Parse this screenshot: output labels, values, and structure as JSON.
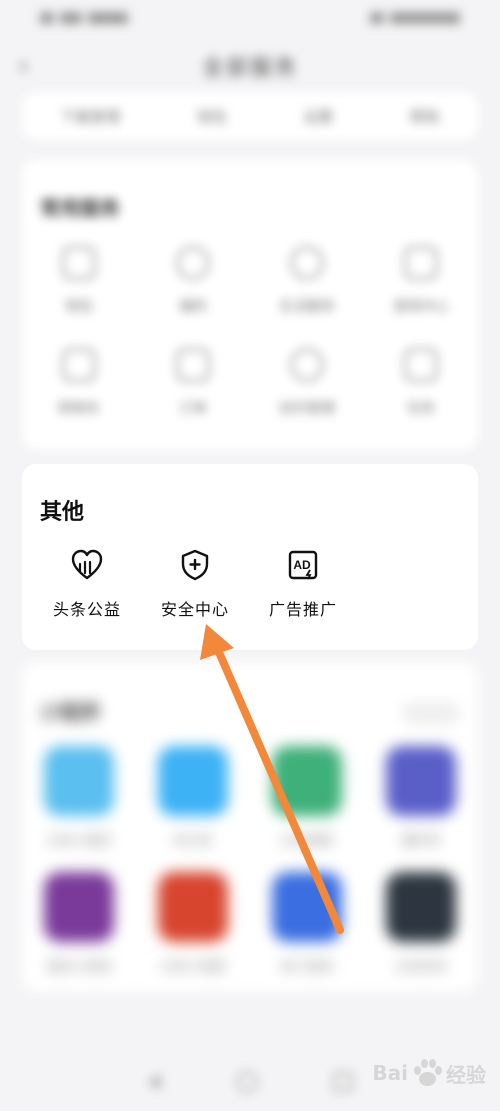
{
  "status_bar": {
    "left": "▮ ▪▮ ▮▮",
    "right": "▮▮ ▮▮▮"
  },
  "header": {
    "title": "全部服务"
  },
  "top_row": [
    "下载管理",
    "钱包",
    "设置",
    "帮助"
  ],
  "common_section": {
    "title": "常用服务",
    "row1": [
      "钱包",
      "福利",
      "生活服务",
      "游戏中心"
    ],
    "row2": [
      "购物车",
      "订单",
      "创作管理",
      "任务"
    ]
  },
  "other_section": {
    "title": "其他",
    "items": [
      {
        "label": "头条公益",
        "icon": "charity-heart-icon"
      },
      {
        "label": "安全中心",
        "icon": "shield-plus-icon"
      },
      {
        "label": "广告推广",
        "icon": "ad-icon"
      }
    ]
  },
  "mini_section": {
    "title": "小程序",
    "more": "全部",
    "row1": [
      "头条小程序",
      "听头条",
      "头条搜索",
      "懂车帝"
    ],
    "row2": [
      "我的小游戏",
      "头条小视频",
      "热门游戏",
      "头条读书"
    ]
  },
  "colors": {
    "arrow": "#f2883a",
    "app1": "#5bbfef",
    "app2": "#3db2f5",
    "app3": "#3fb07a",
    "app4": "#5a5fc8",
    "app5": "#7a3a9a",
    "app6": "#d8452e",
    "app7": "#3b6ee0",
    "app8": "#2d3640"
  },
  "watermark": {
    "brand": "Bai",
    "suffix": "经验"
  }
}
